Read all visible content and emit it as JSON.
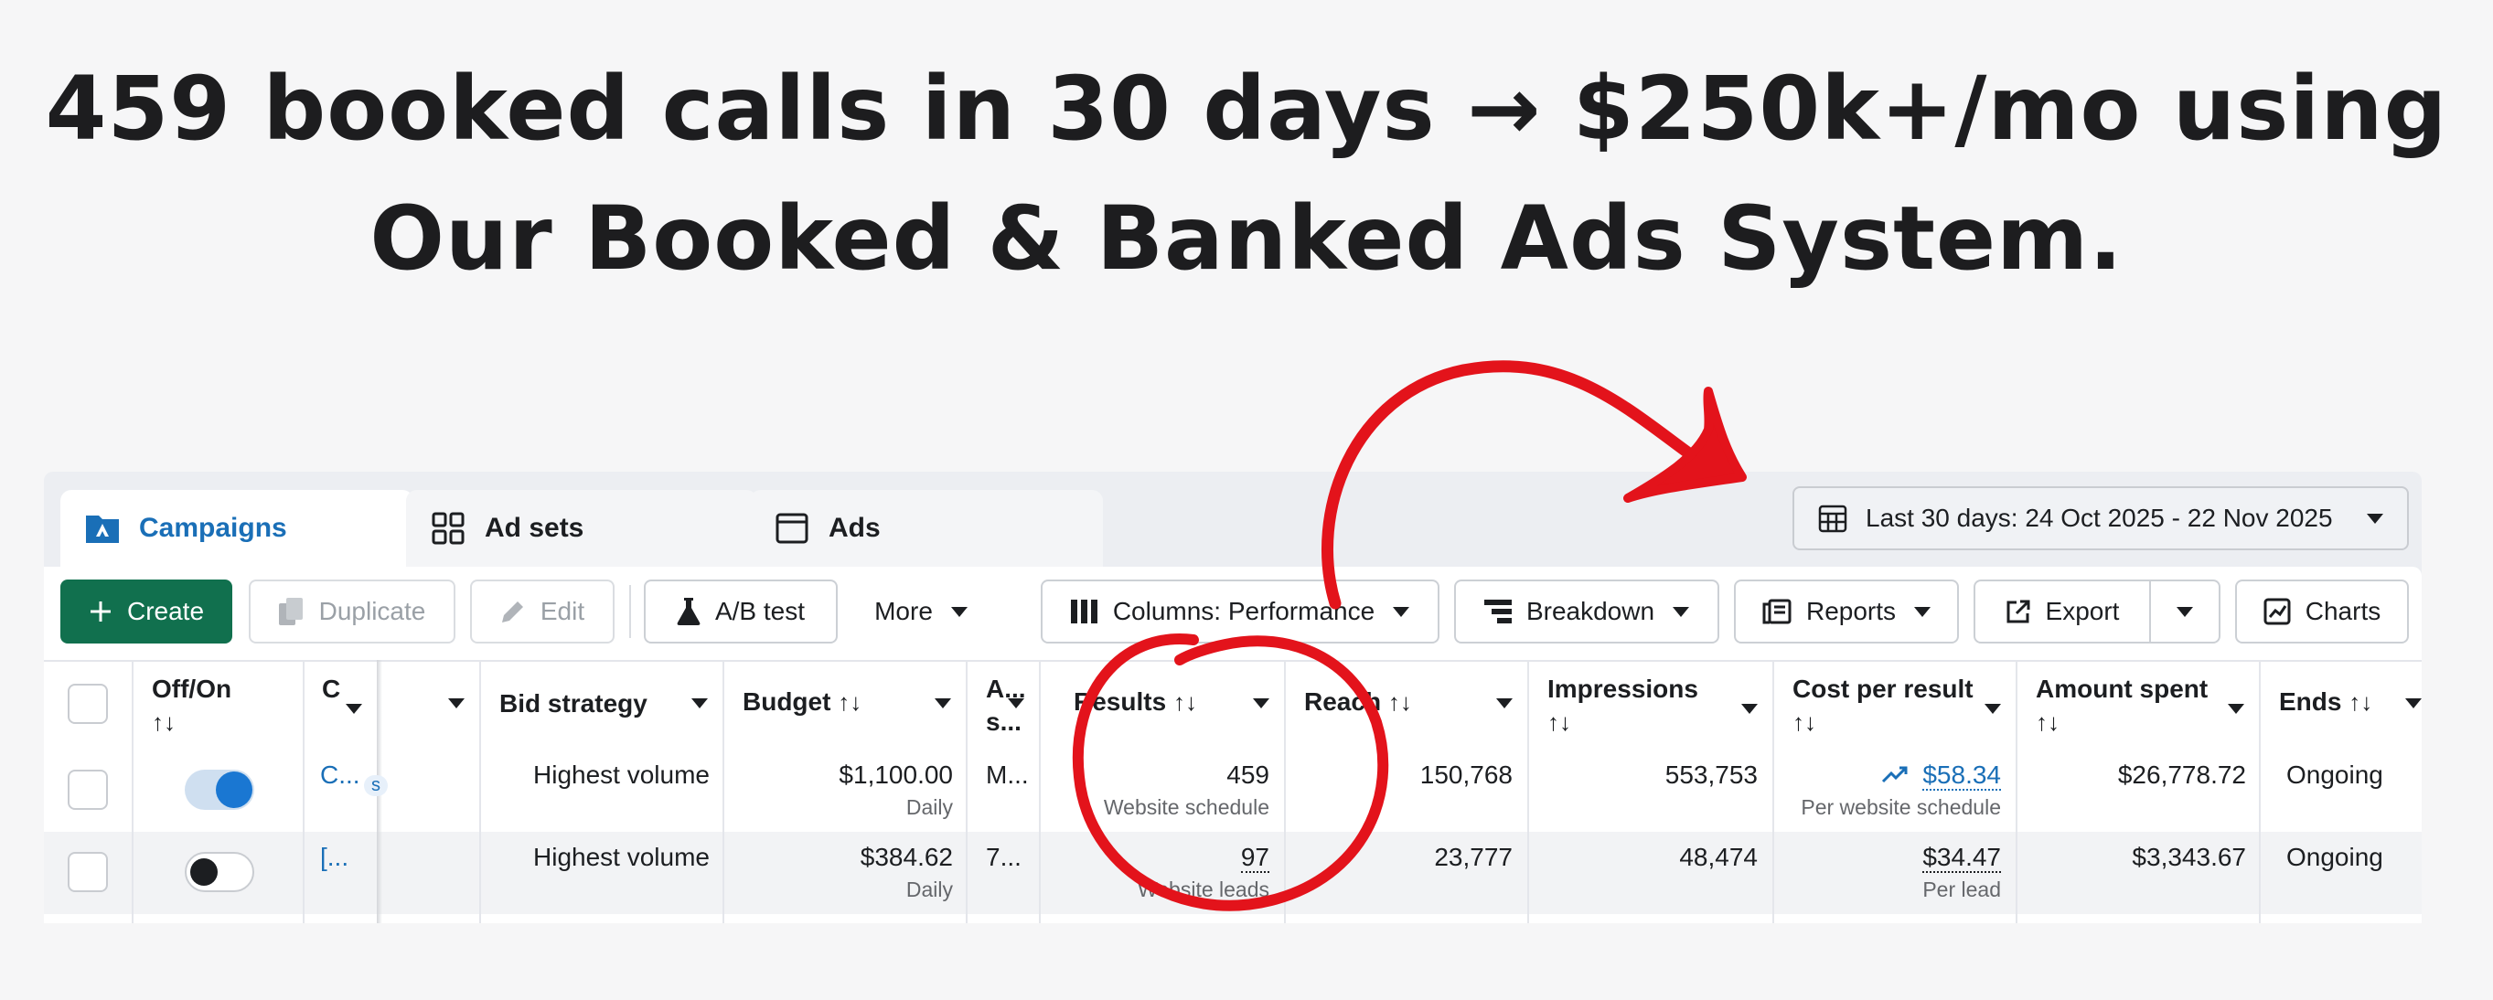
{
  "headline": {
    "line1": "459 booked calls in 30 days → $250k+/mo using",
    "line2": "Our Booked & Banked Ads System."
  },
  "tabs": [
    {
      "label": "Campaigns",
      "icon": "folder-icon",
      "active": true
    },
    {
      "label": "Ad sets",
      "icon": "grid-icon",
      "active": false
    },
    {
      "label": "Ads",
      "icon": "window-icon",
      "active": false
    }
  ],
  "date_range": {
    "label": "Last 30 days: 24 Oct 2025 - 22 Nov 2025",
    "icon": "calendar-icon"
  },
  "toolbar": {
    "create": "Create",
    "duplicate": "Duplicate",
    "edit": "Edit",
    "ab_test": "A/B test",
    "more": "More",
    "columns": "Columns: Performance",
    "breakdown": "Breakdown",
    "reports": "Reports",
    "export": "Export",
    "charts": "Charts"
  },
  "columns": {
    "off_on": "Off/On",
    "sort": "↑↓",
    "campaign_initial": "C",
    "bid_strategy": "Bid strategy",
    "budget": "Budget",
    "attribution": "A...",
    "attribution_2": "s...",
    "results": "Results",
    "reach": "Reach",
    "impressions": "Impressions",
    "cost_per_result": "Cost per result",
    "amount_spent": "Amount spent",
    "ends": "Ends"
  },
  "rows": [
    {
      "toggle": "on",
      "campaign": "C...",
      "campaign_tag": "s",
      "bid_strategy": "Highest volume",
      "budget": "$1,100.00",
      "budget_sub": "Daily",
      "attribution": "M...",
      "results": "459",
      "results_sub": "Website schedule",
      "reach": "150,768",
      "impressions": "553,753",
      "cost_per_result": "$58.34",
      "cost_sub": "Per website schedule",
      "amount_spent": "$26,778.72",
      "ends": "Ongoing"
    },
    {
      "toggle": "off",
      "campaign": "[...",
      "bid_strategy": "Highest volume",
      "budget": "$384.62",
      "budget_sub": "Daily",
      "attribution": "7...",
      "results": "97",
      "results_sub": "Website leads",
      "reach": "23,777",
      "impressions": "48,474",
      "cost_per_result": "$34.47",
      "cost_sub": "Per lead",
      "amount_spent": "$3,343.67",
      "ends": "Ongoing"
    }
  ],
  "colors": {
    "accent": "#1a6fb7",
    "create": "#11704e",
    "annotation": "#e3131b"
  }
}
